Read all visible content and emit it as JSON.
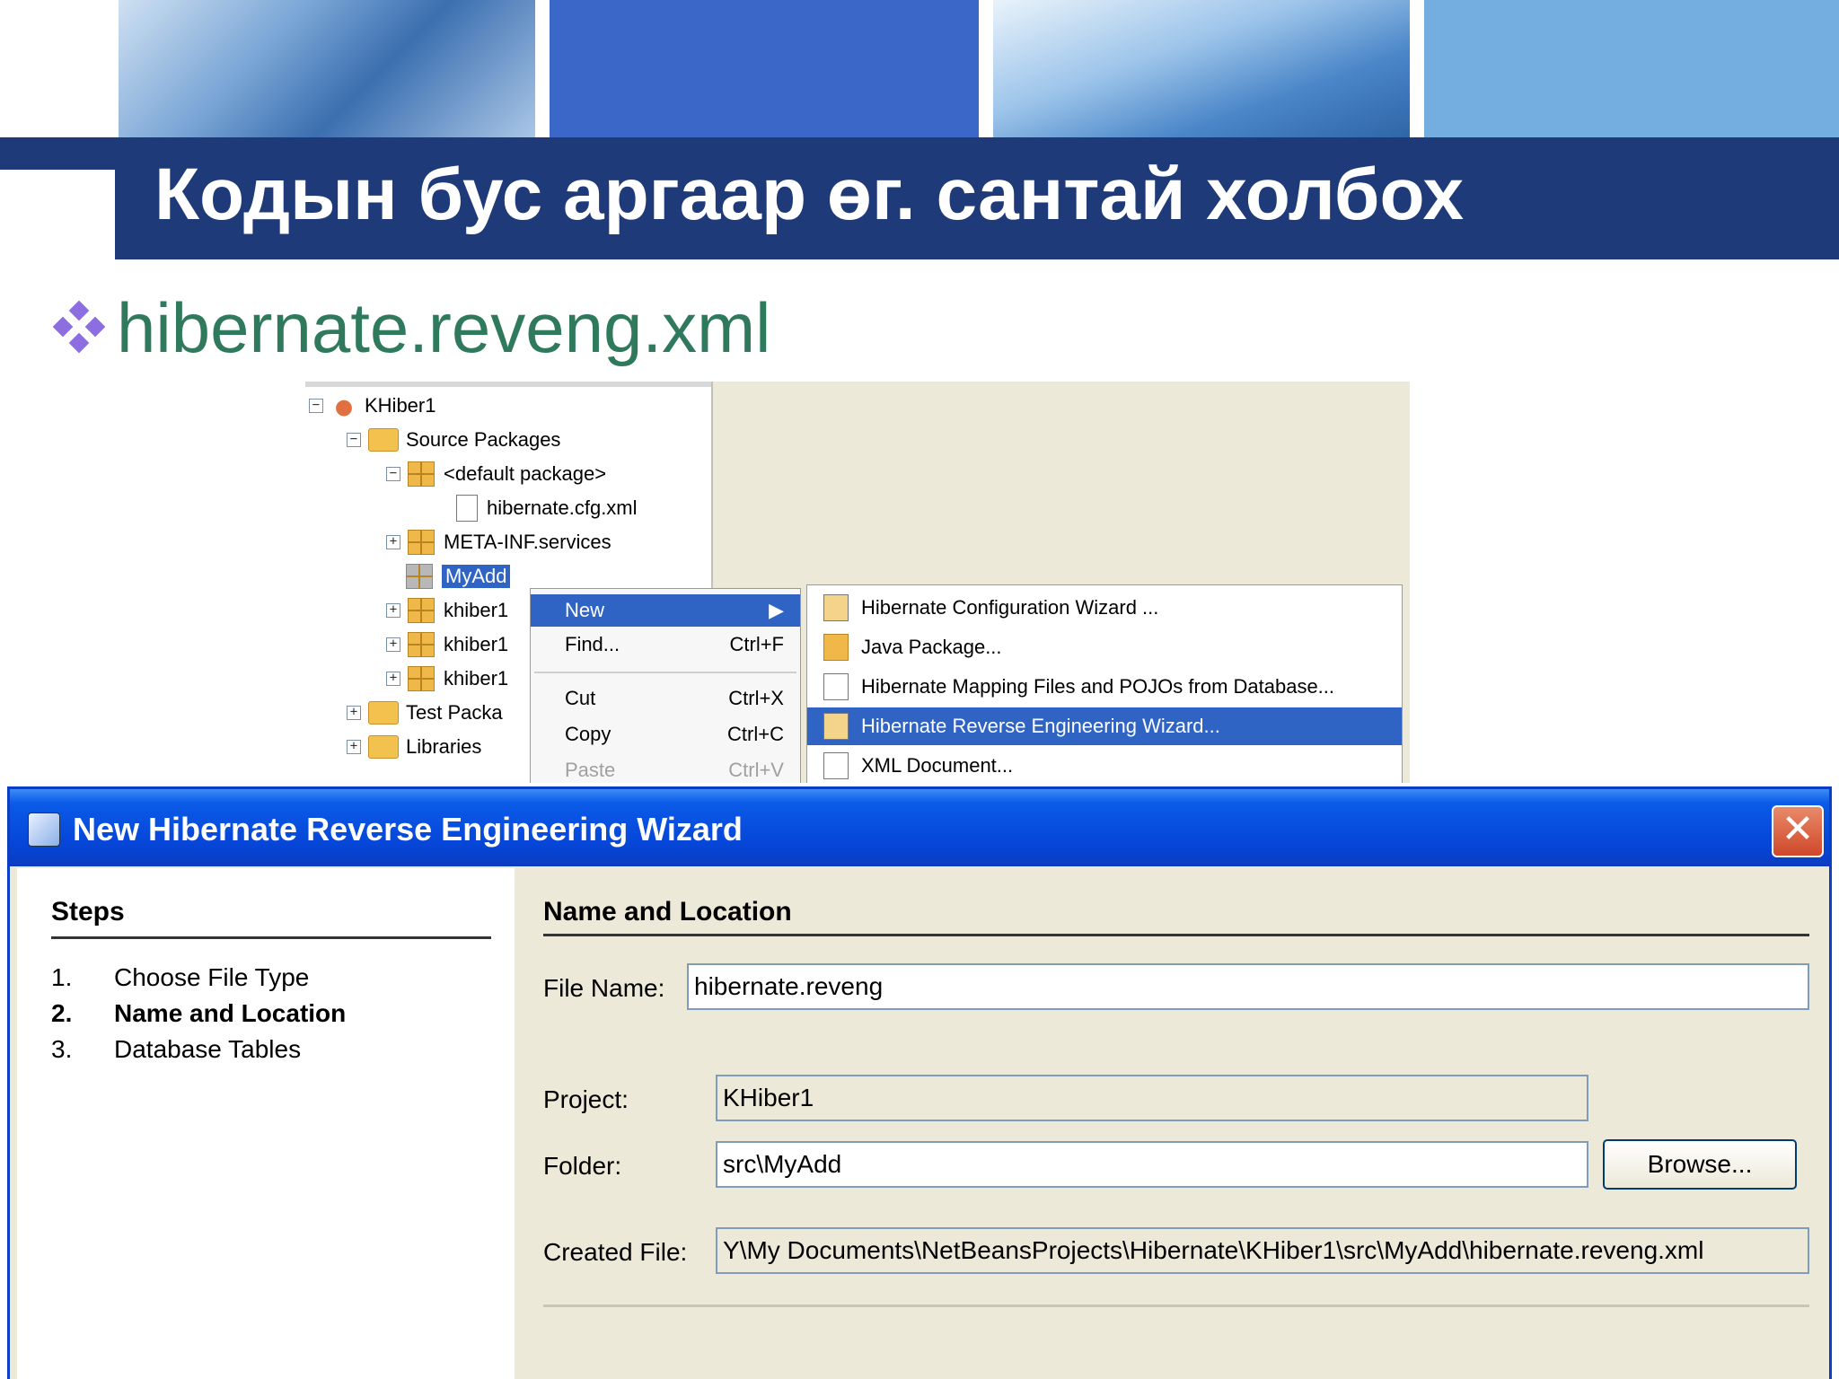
{
  "slide": {
    "title": "Кодын бус аргаар өг. сантай холбох",
    "bullet": "hibernate.reveng.xml"
  },
  "ide": {
    "tree": [
      {
        "label": "KHiber1",
        "icon": "project-icon"
      },
      {
        "label": "Source Packages",
        "icon": "folder-icon"
      },
      {
        "label": "<default package>",
        "icon": "package-icon"
      },
      {
        "label": "hibernate.cfg.xml",
        "icon": "xml-file-icon"
      },
      {
        "label": "META-INF.services",
        "icon": "package-icon"
      },
      {
        "label": "MyAdd",
        "icon": "package-icon",
        "selected": true
      },
      {
        "label": "khiber1",
        "icon": "package-icon"
      },
      {
        "label": "khiber1",
        "icon": "package-icon"
      },
      {
        "label": "khiber1",
        "icon": "package-icon"
      },
      {
        "label": "Test Packa",
        "icon": "folder-icon"
      },
      {
        "label": "Libraries",
        "icon": "folder-icon"
      }
    ],
    "context_menu": [
      {
        "label": "New",
        "shortcut": ""
      },
      {
        "label": "Find...",
        "shortcut": "Ctrl+F"
      },
      {
        "label": "Cut",
        "shortcut": "Ctrl+X"
      },
      {
        "label": "Copy",
        "shortcut": "Ctrl+C"
      },
      {
        "label": "Paste",
        "shortcut": "Ctrl+V"
      }
    ],
    "submenu": [
      "Hibernate Configuration Wizard ...",
      "Java Package...",
      "Hibernate Mapping Files and POJOs from Database...",
      "Hibernate Reverse Engineering Wizard...",
      "XML Document..."
    ]
  },
  "dialog": {
    "title": "New Hibernate Reverse Engineering Wizard",
    "close": "✕",
    "steps_heading": "Steps",
    "steps": [
      {
        "num": "1.",
        "label": "Choose File Type"
      },
      {
        "num": "2.",
        "label": "Name and Location"
      },
      {
        "num": "3.",
        "label": "Database Tables"
      }
    ],
    "panel_heading": "Name and Location",
    "file_name_label": "File Name:",
    "file_name_value": "hibernate.reveng",
    "project_label": "Project:",
    "project_value": "KHiber1",
    "folder_label": "Folder:",
    "folder_value": "src\\MyAdd",
    "browse_label": "Browse...",
    "created_file_label": "Created File:",
    "created_file_value": "Y\\My Documents\\NetBeansProjects\\Hibernate\\KHiber1\\src\\MyAdd\\hibernate.reveng.xml"
  }
}
